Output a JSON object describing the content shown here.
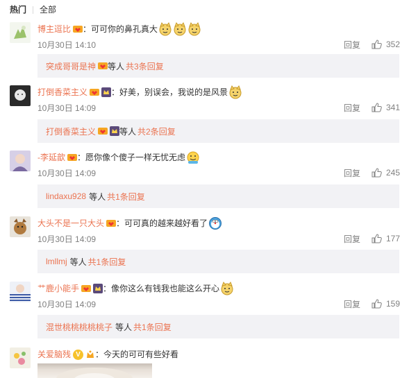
{
  "tabs": {
    "hot": "热门",
    "all": "全部"
  },
  "comments": [
    {
      "user": "博主逗比",
      "text": "：可可你的鼻孔真大",
      "time": "10月30日 14:10",
      "reply_label": "回复",
      "likes": "352",
      "reply_user": "突成哥哥是神",
      "reply_mid": "等人",
      "reply_count": "共3条回复"
    },
    {
      "user": "打倒香菜主义",
      "text": "：好美，别误会，我说的是风景",
      "time": "10月30日 14:09",
      "reply_label": "回复",
      "likes": "341",
      "reply_user": "打倒香菜主义",
      "reply_mid": "等人",
      "reply_count": "共2条回复"
    },
    {
      "user": "-李延歆",
      "text": "：愿你像个傻子一样无忧无虑",
      "time": "10月30日 14:09",
      "reply_label": "回复",
      "likes": "245",
      "reply_user": "lindaxu928",
      "reply_mid": "等人",
      "reply_count": "共1条回复"
    },
    {
      "user": "大头不是一只大头",
      "text": "：可可真的越来越好看了",
      "time": "10月30日 14:09",
      "reply_label": "回复",
      "likes": "177",
      "reply_user": "lmllmj",
      "reply_mid": "等人",
      "reply_count": "共1条回复"
    },
    {
      "user": "艹鹿小能手",
      "text": "：像你这么有钱我也能这么开心",
      "time": "10月30日 14:09",
      "reply_label": "回复",
      "likes": "159",
      "reply_user": "混世桃桃桃桃桃子",
      "reply_mid": "等人",
      "reply_count": "共1条回复"
    },
    {
      "user": "关爱脑残",
      "text": "：今天的可可有些好看",
      "verified_mark": "V"
    }
  ],
  "colors": {
    "username": "#eb7350",
    "meta": "#808080",
    "reply_bg": "#f2f2f5"
  }
}
